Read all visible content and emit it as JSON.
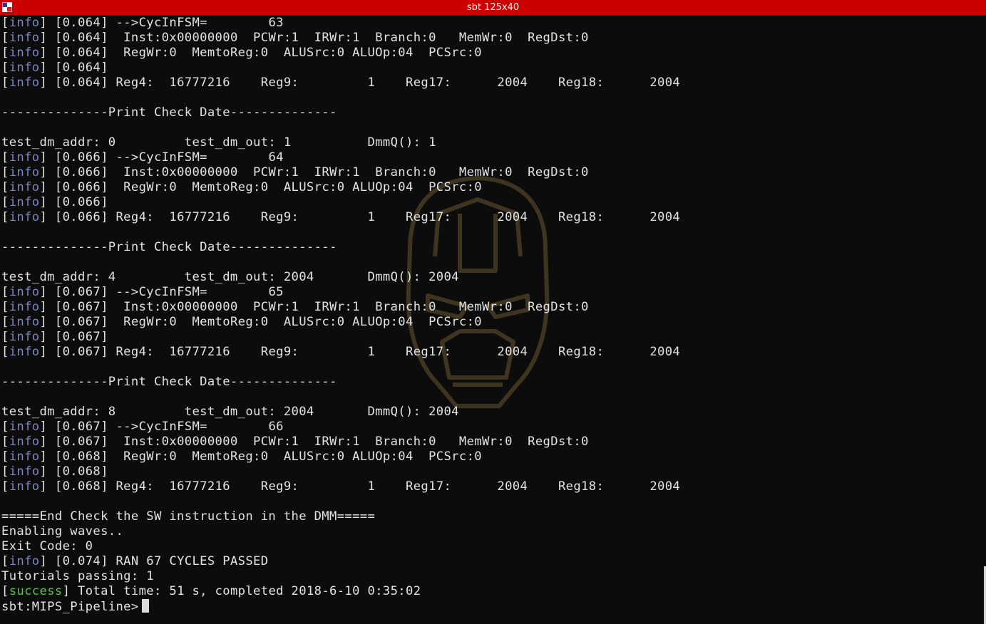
{
  "window": {
    "title": "sbt 125x40"
  },
  "terminal": {
    "lines": [
      {
        "tag": "info",
        "text": " [0.064] -->CycInFSM=        63"
      },
      {
        "tag": "info",
        "text": " [0.064]  Inst:0x00000000  PCWr:1  IRWr:1  Branch:0   MemWr:0  RegDst:0"
      },
      {
        "tag": "info",
        "text": " [0.064]  RegWr:0  MemtoReg:0  ALUSrc:0 ALUOp:04  PCSrc:0"
      },
      {
        "tag": "info",
        "text": " [0.064]"
      },
      {
        "tag": "info",
        "text": " [0.064] Reg4:  16777216    Reg9:         1    Reg17:      2004    Reg18:      2004"
      },
      {
        "tag": "",
        "text": ""
      },
      {
        "tag": "",
        "text": "--------------Print Check Date--------------"
      },
      {
        "tag": "",
        "text": ""
      },
      {
        "tag": "",
        "text": "test_dm_addr: 0         test_dm_out: 1          DmmQ(): 1"
      },
      {
        "tag": "info",
        "text": " [0.066] -->CycInFSM=        64"
      },
      {
        "tag": "info",
        "text": " [0.066]  Inst:0x00000000  PCWr:1  IRWr:1  Branch:0   MemWr:0  RegDst:0"
      },
      {
        "tag": "info",
        "text": " [0.066]  RegWr:0  MemtoReg:0  ALUSrc:0 ALUOp:04  PCSrc:0"
      },
      {
        "tag": "info",
        "text": " [0.066]"
      },
      {
        "tag": "info",
        "text": " [0.066] Reg4:  16777216    Reg9:         1    Reg17:      2004    Reg18:      2004"
      },
      {
        "tag": "",
        "text": ""
      },
      {
        "tag": "",
        "text": "--------------Print Check Date--------------"
      },
      {
        "tag": "",
        "text": ""
      },
      {
        "tag": "",
        "text": "test_dm_addr: 4         test_dm_out: 2004       DmmQ(): 2004"
      },
      {
        "tag": "info",
        "text": " [0.067] -->CycInFSM=        65"
      },
      {
        "tag": "info",
        "text": " [0.067]  Inst:0x00000000  PCWr:1  IRWr:1  Branch:0   MemWr:0  RegDst:0"
      },
      {
        "tag": "info",
        "text": " [0.067]  RegWr:0  MemtoReg:0  ALUSrc:0 ALUOp:04  PCSrc:0"
      },
      {
        "tag": "info",
        "text": " [0.067]"
      },
      {
        "tag": "info",
        "text": " [0.067] Reg4:  16777216    Reg9:         1    Reg17:      2004    Reg18:      2004"
      },
      {
        "tag": "",
        "text": ""
      },
      {
        "tag": "",
        "text": "--------------Print Check Date--------------"
      },
      {
        "tag": "",
        "text": ""
      },
      {
        "tag": "",
        "text": "test_dm_addr: 8         test_dm_out: 2004       DmmQ(): 2004"
      },
      {
        "tag": "info",
        "text": " [0.067] -->CycInFSM=        66"
      },
      {
        "tag": "info",
        "text": " [0.067]  Inst:0x00000000  PCWr:1  IRWr:1  Branch:0   MemWr:0  RegDst:0"
      },
      {
        "tag": "info",
        "text": " [0.068]  RegWr:0  MemtoReg:0  ALUSrc:0 ALUOp:04  PCSrc:0"
      },
      {
        "tag": "info",
        "text": " [0.068]"
      },
      {
        "tag": "info",
        "text": " [0.068] Reg4:  16777216    Reg9:         1    Reg17:      2004    Reg18:      2004"
      },
      {
        "tag": "",
        "text": ""
      },
      {
        "tag": "",
        "text": "=====End Check the SW instruction in the DMM====="
      },
      {
        "tag": "",
        "text": "Enabling waves.."
      },
      {
        "tag": "",
        "text": "Exit Code: 0"
      },
      {
        "tag": "info",
        "text": " [0.074] RAN 67 CYCLES PASSED"
      },
      {
        "tag": "",
        "text": "Tutorials passing: 1"
      },
      {
        "tag": "success",
        "text": " Total time: 51 s, completed 2018-6-10 0:35:02"
      }
    ],
    "prompt": "sbt:MIPS_Pipeline>"
  },
  "colors": {
    "titlebar": "#cc0000",
    "background": "#0c0c0c",
    "text": "#e2e2e2",
    "info_tag": "#7d86c4",
    "success_tag": "#5bc24b"
  },
  "icons": {
    "app": "app-grid-icon",
    "watermark": "iron-man-helmet-watermark"
  }
}
